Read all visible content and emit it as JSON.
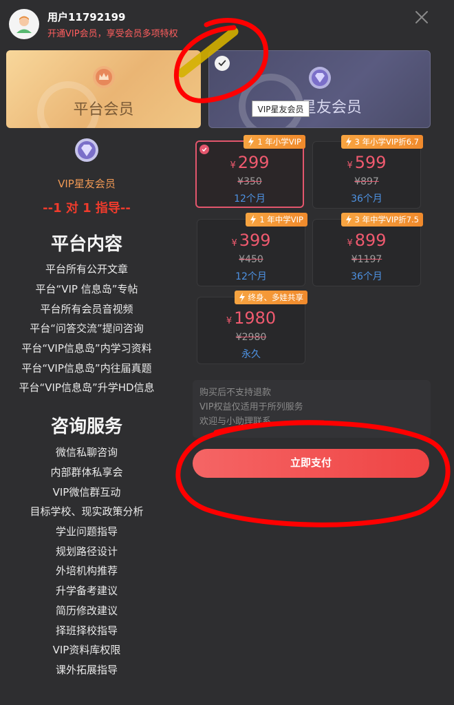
{
  "header": {
    "username": "用户11792199",
    "subtitle": "开通VIP会员，享受会员多项特权"
  },
  "tabs": {
    "platform": "平台会员",
    "star": "VIP星友会员",
    "tooltip": "VIP星友会员"
  },
  "left": {
    "vip_name": "VIP星友会员",
    "guide": "--1 对 1 指导--",
    "content_heading": "平台内容",
    "content_items": [
      "平台所有公开文章",
      "平台“VIP 信息岛”专帖",
      "平台所有会员音视频",
      "平台“问答交流”提问咨询",
      "平台“VIP信息岛”内学习资料",
      "平台“VIP信息岛”内往届真题",
      "平台“VIP信息岛”升学HD信息"
    ],
    "service_heading": "咨询服务",
    "service_items": [
      "微信私聊咨询",
      "内部群体私享会",
      "VIP微信群互动",
      "目标学校、现实政策分析",
      "学业问题指导",
      "规划路径设计",
      "外培机构推荐",
      "升学备考建议",
      "简历修改建议",
      "择班择校指导",
      "VIP资料库权限",
      "课外拓展指导"
    ]
  },
  "plans": [
    {
      "badge": "1 年小学VIP",
      "yen": "¥",
      "price": "299",
      "old": "¥350",
      "duration": "12个月"
    },
    {
      "badge": "3 年小学VIP折6.7",
      "yen": "¥",
      "price": "599",
      "old": "¥897",
      "duration": "36个月"
    },
    {
      "badge": "1 年中学VIP",
      "yen": "¥",
      "price": "399",
      "old": "¥450",
      "duration": "12个月"
    },
    {
      "badge": "3 年中学VIP折7.5",
      "yen": "¥",
      "price": "899",
      "old": "¥1197",
      "duration": "36个月"
    },
    {
      "badge": "终身、多娃共享",
      "yen": "¥",
      "price": "1980",
      "old": "¥2980",
      "duration": "永久"
    }
  ],
  "notes": [
    "购买后不支持退款",
    "VIP权益仅适用于所列服务",
    "欢迎与小助理联系"
  ],
  "pay_label": "立即支付",
  "colors": {
    "background": "#2e2e30",
    "accent_red": "#ef4444",
    "price_red": "#f05a6f",
    "duration_blue": "#4e93e4",
    "badge_orange": "#f7a441",
    "annotation_red": "#ff0000"
  }
}
